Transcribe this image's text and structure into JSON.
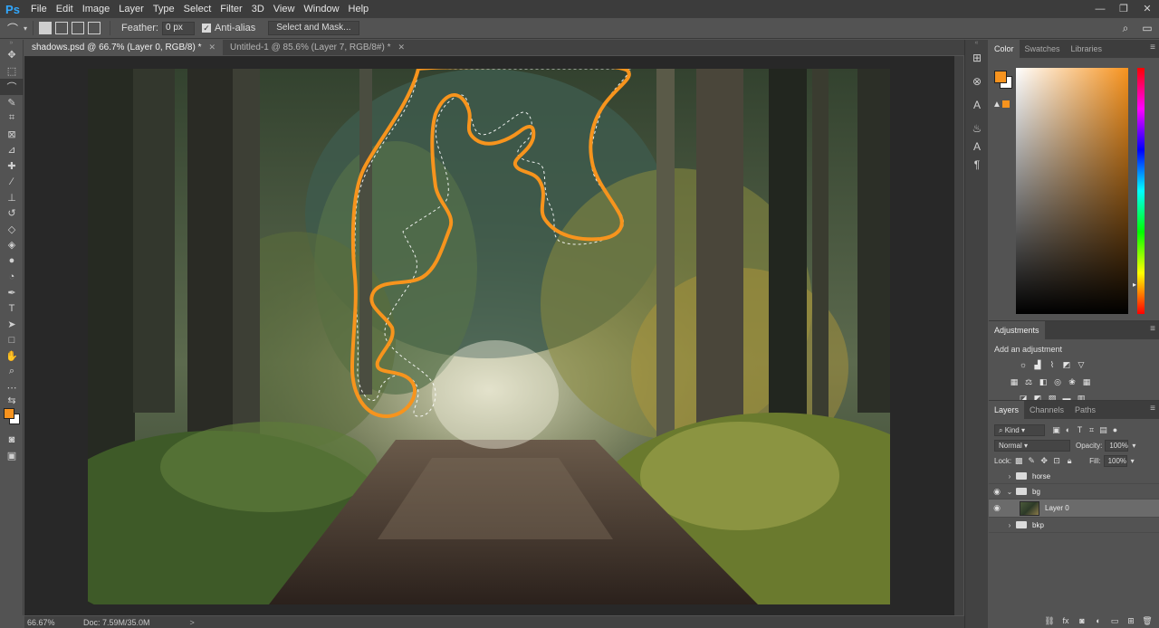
{
  "app": {
    "logo": "Ps",
    "menu": [
      "File",
      "Edit",
      "Image",
      "Layer",
      "Type",
      "Select",
      "Filter",
      "3D",
      "View",
      "Window",
      "Help"
    ],
    "window_controls": [
      "—",
      "❐",
      "✕"
    ]
  },
  "options": {
    "feather_label": "Feather:",
    "feather_value": "0 px",
    "antialias_label": "Anti-alias",
    "antialias_checked": true,
    "select_mask_label": "Select and Mask..."
  },
  "colors": {
    "foreground": "#f7931e",
    "background": "#ffffff",
    "selection_stroke": "#f7941d",
    "accent_blue": "#31a8ff"
  },
  "doc_tabs": [
    {
      "label": "shadows.psd @ 66.7% (Layer 0, RGB/8) *",
      "active": true
    },
    {
      "label": "Untitled-1 @ 85.6% (Layer 7, RGB/8#) *",
      "active": false
    }
  ],
  "status": {
    "zoom": "66.67%",
    "doc_size": "Doc: 7.59M/35.0M",
    "arrow": ">"
  },
  "panels": {
    "color_tabs": [
      "Color",
      "Swatches",
      "Libraries"
    ],
    "adjustments_tab": "Adjustments",
    "adjustments_title": "Add an adjustment",
    "layers_tabs": [
      "Layers",
      "Channels",
      "Paths"
    ],
    "filter_kind": "Kind",
    "blend_mode": "Normal",
    "opacity_label": "Opacity:",
    "opacity_value": "100%",
    "lock_label": "Lock:",
    "fill_label": "Fill:",
    "fill_value": "100%"
  },
  "layers": [
    {
      "name": "horse",
      "type": "group",
      "visible": false,
      "expanded": false
    },
    {
      "name": "bg",
      "type": "group",
      "visible": true,
      "expanded": true
    },
    {
      "name": "Layer 0",
      "type": "layer",
      "visible": true,
      "selected": true
    },
    {
      "name": "bkp",
      "type": "group",
      "visible": false,
      "expanded": false
    }
  ]
}
